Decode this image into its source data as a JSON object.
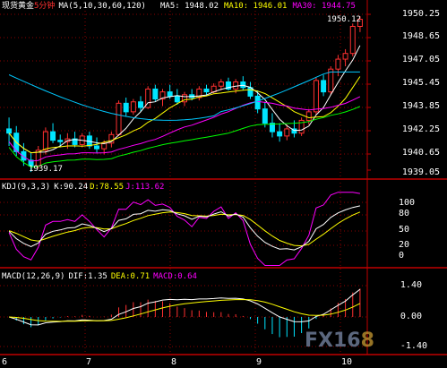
{
  "main": {
    "symbol": "现货黄金",
    "period": "5分钟",
    "ma_label": "MA(5,10,30,60,120)",
    "ma5": "MA5: 1948.02",
    "ma10": "MA10: 1946.01",
    "ma30": "MA30: 1944.75",
    "y_ticks": [
      "1950.25",
      "1948.65",
      "1947.05",
      "1945.45",
      "1943.85",
      "1942.25",
      "1940.65",
      "1939.05"
    ],
    "high_note": "1950.12",
    "low_note": "1939.17"
  },
  "kdj": {
    "label": "KDJ(9,3,3)",
    "k": "K:90.24",
    "d": "D:78.55",
    "j": "J:113.62",
    "y_ticks": [
      "100",
      "80",
      "50",
      "20",
      "0"
    ]
  },
  "macd": {
    "label": "MACD(12,26,9)",
    "dif": "DIF:1.35",
    "dea": "DEA:0.71",
    "macd": "MACD:0.64",
    "y_ticks": [
      "1.40",
      "0.00",
      "-1.40"
    ]
  },
  "x_labels": [
    "6",
    "7",
    "8",
    "9",
    "10"
  ],
  "watermark": {
    "left": "FX16",
    "right": "8"
  },
  "colors": {
    "up": "#ff3030",
    "down": "#00e5ff",
    "grid": "#8b0000",
    "ma5": "#ffffff",
    "ma10": "#ffff00",
    "ma30": "#ff00ff",
    "ma60": "#00ff00",
    "ma120": "#00c8ff"
  },
  "chart_data": {
    "type": "candlestick",
    "ylim": [
      1939.05,
      1950.25
    ],
    "candles": [
      [
        1942.2,
        1943.0,
        1941.0,
        1941.9
      ],
      [
        1941.9,
        1942.4,
        1940.3,
        1940.6
      ],
      [
        1940.6,
        1941.2,
        1939.6,
        1940.0
      ],
      [
        1940.0,
        1940.5,
        1939.17,
        1939.6
      ],
      [
        1939.6,
        1941.0,
        1939.4,
        1940.7
      ],
      [
        1940.7,
        1942.3,
        1940.4,
        1942.0
      ],
      [
        1942.0,
        1942.6,
        1941.2,
        1941.4
      ],
      [
        1941.4,
        1941.8,
        1940.9,
        1941.3
      ],
      [
        1941.3,
        1941.9,
        1940.8,
        1941.5
      ],
      [
        1941.5,
        1942.0,
        1940.9,
        1941.1
      ],
      [
        1941.1,
        1941.9,
        1940.9,
        1941.7
      ],
      [
        1941.7,
        1942.0,
        1940.8,
        1941.0
      ],
      [
        1941.0,
        1941.6,
        1940.5,
        1940.8
      ],
      [
        1940.8,
        1941.4,
        1940.4,
        1941.2
      ],
      [
        1941.2,
        1942.0,
        1940.9,
        1941.8
      ],
      [
        1941.8,
        1944.2,
        1941.7,
        1944.0
      ],
      [
        1944.0,
        1944.4,
        1943.1,
        1943.4
      ],
      [
        1943.4,
        1944.3,
        1943.2,
        1944.1
      ],
      [
        1944.1,
        1944.5,
        1943.4,
        1943.7
      ],
      [
        1943.7,
        1945.2,
        1943.6,
        1945.0
      ],
      [
        1945.0,
        1945.3,
        1944.1,
        1944.3
      ],
      [
        1944.3,
        1945.0,
        1943.8,
        1944.8
      ],
      [
        1944.8,
        1945.3,
        1944.3,
        1944.5
      ],
      [
        1944.5,
        1945.0,
        1943.9,
        1944.1
      ],
      [
        1944.1,
        1944.8,
        1943.8,
        1944.6
      ],
      [
        1944.6,
        1945.0,
        1944.2,
        1944.4
      ],
      [
        1944.4,
        1945.2,
        1944.2,
        1945.0
      ],
      [
        1945.0,
        1945.3,
        1944.6,
        1944.8
      ],
      [
        1944.8,
        1945.4,
        1944.7,
        1945.2
      ],
      [
        1945.2,
        1945.7,
        1944.9,
        1945.5
      ],
      [
        1945.5,
        1945.8,
        1944.9,
        1945.0
      ],
      [
        1945.0,
        1945.7,
        1944.7,
        1945.5
      ],
      [
        1945.5,
        1945.9,
        1944.9,
        1945.1
      ],
      [
        1945.1,
        1945.5,
        1944.3,
        1944.5
      ],
      [
        1944.5,
        1944.9,
        1943.3,
        1943.6
      ],
      [
        1943.6,
        1944.1,
        1942.3,
        1942.6
      ],
      [
        1942.6,
        1943.3,
        1941.6,
        1942.0
      ],
      [
        1942.0,
        1942.6,
        1941.3,
        1941.7
      ],
      [
        1941.7,
        1942.5,
        1941.4,
        1942.2
      ],
      [
        1942.2,
        1942.8,
        1941.6,
        1941.9
      ],
      [
        1941.9,
        1943.0,
        1941.7,
        1942.8
      ],
      [
        1942.8,
        1943.6,
        1942.5,
        1943.4
      ],
      [
        1943.4,
        1945.8,
        1943.2,
        1945.6
      ],
      [
        1945.6,
        1946.0,
        1944.5,
        1944.8
      ],
      [
        1944.8,
        1946.6,
        1944.6,
        1946.4
      ],
      [
        1946.4,
        1947.4,
        1945.9,
        1947.1
      ],
      [
        1947.1,
        1947.8,
        1946.6,
        1947.5
      ],
      [
        1947.5,
        1949.6,
        1947.3,
        1949.4
      ],
      [
        1949.4,
        1950.12,
        1949.0,
        1949.9
      ]
    ]
  }
}
